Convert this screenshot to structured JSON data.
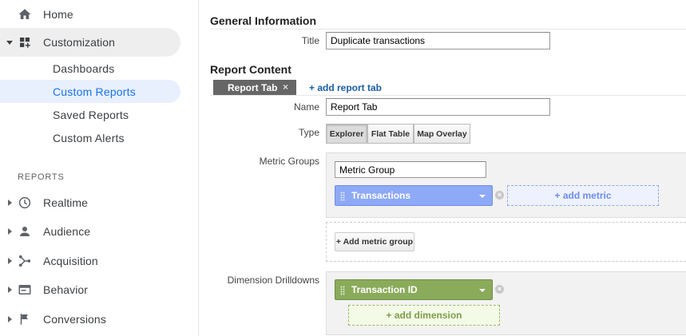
{
  "sidebar": {
    "home": "Home",
    "customization": "Customization",
    "sub_items": [
      "Dashboards",
      "Custom Reports",
      "Saved Reports",
      "Custom Alerts"
    ],
    "reports_header": "REPORTS",
    "reports": [
      {
        "label": "Realtime",
        "icon": "clock-icon"
      },
      {
        "label": "Audience",
        "icon": "person-icon"
      },
      {
        "label": "Acquisition",
        "icon": "acquisition-icon"
      },
      {
        "label": "Behavior",
        "icon": "behavior-icon"
      },
      {
        "label": "Conversions",
        "icon": "flag-icon"
      }
    ]
  },
  "general": {
    "heading": "General Information",
    "title_label": "Title",
    "title_value": "Duplicate transactions"
  },
  "content": {
    "heading": "Report Content",
    "tab_label": "Report Tab",
    "tab_close": "×",
    "add_tab": "+ add report tab",
    "name_label": "Name",
    "name_value": "Report Tab",
    "type_label": "Type",
    "types": [
      "Explorer",
      "Flat Table",
      "Map Overlay"
    ],
    "metric_groups_label": "Metric Groups",
    "metric_group_name": "Metric Group",
    "metric_chip": "Transactions",
    "add_metric": "+ add metric",
    "add_metric_group": "+ Add metric group",
    "dimension_label": "Dimension Drilldowns",
    "dimension_chip": "Transaction ID",
    "add_dimension": "+ add dimension",
    "remove_glyph": "×"
  },
  "colors": {
    "metric_blue": "#8ea9f5",
    "dimension_green": "#8aab5a",
    "active_nav": "#1a73e8",
    "link": "#1a5ea6"
  }
}
